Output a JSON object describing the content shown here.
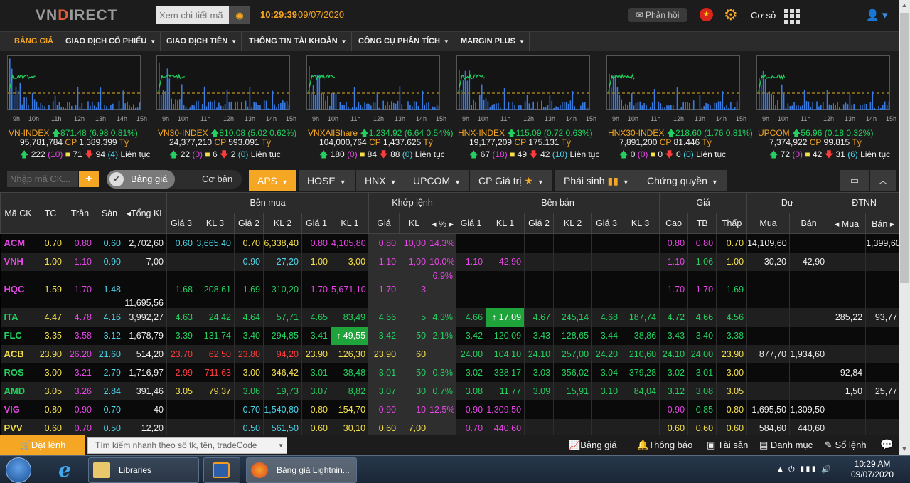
{
  "header": {
    "logo_a": "VN",
    "logo_b": "D",
    "logo_c": "IRECT",
    "search_placeholder": "Xem chi tiết mã",
    "time": "10:29:39",
    "date": "09/07/2020",
    "feedback": "Phản hồi",
    "mode": "Cơ sở"
  },
  "nav": [
    "BẢNG GIÁ",
    "GIAO DỊCH CỔ PHIẾU",
    "GIAO DỊCH TIỀN",
    "THÔNG TIN TÀI KHOẢN",
    "CÔNG CỤ PHÂN TÍCH",
    "MARGIN PLUS"
  ],
  "time_ticks": [
    "9h",
    "10h",
    "11h",
    "12h",
    "13h",
    "14h",
    "15h"
  ],
  "indexes": [
    {
      "name": "VN-INDEX",
      "value": "871.48",
      "change": "(6.98 0.81%)",
      "volume": "95,781,784",
      "cp": "CP",
      "amount": "1,389.399",
      "unit": "Tỷ",
      "up": "222",
      "ref": "(10)",
      "ceil": "71",
      "down": "94",
      "floor": "(4)",
      "status": "Liên tục"
    },
    {
      "name": "VN30-INDEX",
      "value": "810.08",
      "change": "(5.02 0.62%)",
      "volume": "24,377,210",
      "cp": "CP",
      "amount": "593.091",
      "unit": "Tỷ",
      "up": "22",
      "ref": "(0)",
      "ceil": "6",
      "down": "2",
      "floor": "(0)",
      "status": "Liên tục"
    },
    {
      "name": "VNXAllShare",
      "value": "1,234.92",
      "change": "(6.64 0.54%)",
      "volume": "104,000,764",
      "cp": "CP",
      "amount": "1,437.625",
      "unit": "Tỷ",
      "up": "180",
      "ref": "(0)",
      "ceil": "84",
      "down": "88",
      "floor": "(0)",
      "status": "Liên tục"
    },
    {
      "name": "HNX-INDEX",
      "value": "115.09",
      "change": "(0.72 0.63%)",
      "volume": "19,177,209",
      "cp": "CP",
      "amount": "175.131",
      "unit": "Tỷ",
      "up": "67",
      "ref": "(18)",
      "ceil": "49",
      "down": "42",
      "floor": "(10)",
      "status": "Liên tục"
    },
    {
      "name": "HNX30-INDEX",
      "value": "218.60",
      "change": "(1.76 0.81%)",
      "volume": "7,891,200",
      "cp": "CP",
      "amount": "81.446",
      "unit": "Tỷ",
      "up": "0",
      "ref": "(0)",
      "ceil": "0",
      "down": "0",
      "floor": "(0)",
      "status": "Liên tục"
    },
    {
      "name": "UPCOM",
      "value": "56.96",
      "change": "(0.18 0.32%)",
      "volume": "7,374,922",
      "cp": "CP",
      "amount": "99.815",
      "unit": "Tỷ",
      "up": "72",
      "ref": "(0)",
      "ceil": "42",
      "down": "31",
      "floor": "(6)",
      "status": "Liên tục"
    }
  ],
  "filter": {
    "search_placeholder": "Nhập mã CK...",
    "toggle_on": "Bảng giá",
    "toggle_off": "Cơ bản",
    "tabs": [
      "APS",
      "HOSE",
      "HNX",
      "UPCOM",
      "CP Giá trị",
      "Phái sinh",
      "Chứng quyền"
    ]
  },
  "table": {
    "groups": [
      "Mã CK",
      "TC",
      "Trần",
      "Sàn",
      "Tổng KL",
      "Bên mua",
      "Khớp lệnh",
      "Bên bán",
      "Giá",
      "Dư",
      "ĐTNN"
    ],
    "sub": [
      "Giá 3",
      "KL 3",
      "Giá 2",
      "KL 2",
      "Giá 1",
      "KL 1",
      "Giá",
      "KL",
      "%",
      "Giá 1",
      "KL 1",
      "Giá 2",
      "KL 2",
      "Giá 3",
      "KL 3",
      "Cao",
      "TB",
      "Thấp",
      "Mua",
      "Bán",
      "Mua",
      "Bán"
    ],
    "rows": [
      {
        "sym": "ACM",
        "tc": "0.70",
        "tran": "0.80",
        "san": "0.60",
        "tkl": "2,702,60",
        "g3": "0.60",
        "kl3": "3,665,40",
        "g2": "0.70",
        "kl2": "6,338,40",
        "g1": "0.80",
        "kl1": "4,105,80",
        "kg": "0.80",
        "kkl": "10,00",
        "kp": "14.3%",
        "sg1": "",
        "skl1": "",
        "sg2": "",
        "skl2": "",
        "sg3": "",
        "skl3": "",
        "cao": "0.80",
        "tb": "0.80",
        "thap": "0.70",
        "dmua": "14,109,60",
        "dban": "",
        "nmua": "",
        "nban": "1,399,60"
      },
      {
        "sym": "VNH",
        "tc": "1.00",
        "tran": "1.10",
        "san": "0.90",
        "tkl": "7,00",
        "g3": "",
        "kl3": "",
        "g2": "0.90",
        "kl2": "27,20",
        "g1": "1.00",
        "kl1": "3,00",
        "kg": "1.10",
        "kkl": "1,00",
        "kp": "10.0%",
        "sg1": "1.10",
        "skl1": "42,90",
        "sg2": "",
        "skl2": "",
        "sg3": "",
        "skl3": "",
        "cao": "1.10",
        "tb": "1.06",
        "thap": "1.00",
        "dmua": "30,20",
        "dban": "42,90",
        "nmua": "",
        "nban": ""
      },
      {
        "sym": "HQC",
        "tc": "1.59",
        "tran": "1.70",
        "san": "1.48",
        "tkl": "11,695,56",
        "g3": "1.68",
        "kl3": "208,61",
        "g2": "1.69",
        "kl2": "310,20",
        "g1": "1.70",
        "kl1": "5,671,10",
        "kg": "1.70",
        "kkl": "3",
        "kp": "6.9%",
        "sg1": "",
        "skl1": "",
        "sg2": "",
        "skl2": "",
        "sg3": "",
        "skl3": "",
        "cao": "1.70",
        "tb": "1.70",
        "thap": "1.69",
        "dmua": "",
        "dban": "",
        "nmua": "",
        "nban": ""
      },
      {
        "sym": "ITA",
        "tc": "4.47",
        "tran": "4.78",
        "san": "4.16",
        "tkl": "3,992,27",
        "g3": "4.63",
        "kl3": "24,42",
        "g2": "4.64",
        "kl2": "57,71",
        "g1": "4.65",
        "kl1": "83,49",
        "kg": "4.66",
        "kkl": "5",
        "kp": "4.3%",
        "sg1": "4.66",
        "skl1": "↑ 17,09",
        "sg2": "4.67",
        "skl2": "245,14",
        "sg3": "4.68",
        "skl3": "187,74",
        "cao": "4.72",
        "tb": "4.66",
        "thap": "4.56",
        "dmua": "",
        "dban": "",
        "nmua": "285,22",
        "nban": "93,77"
      },
      {
        "sym": "FLC",
        "tc": "3.35",
        "tran": "3.58",
        "san": "3.12",
        "tkl": "1,678,79",
        "g3": "3.39",
        "kl3": "131,74",
        "g2": "3.40",
        "kl2": "294,85",
        "g1": "3.41",
        "kl1": "↑ 49,55",
        "kg": "3.42",
        "kkl": "50",
        "kp": "2.1%",
        "sg1": "3.42",
        "skl1": "120,09",
        "sg2": "3.43",
        "skl2": "128,65",
        "sg3": "3.44",
        "skl3": "38,86",
        "cao": "3.43",
        "tb": "3.40",
        "thap": "3.38",
        "dmua": "",
        "dban": "",
        "nmua": "",
        "nban": ""
      },
      {
        "sym": "ACB",
        "tc": "23.90",
        "tran": "26.20",
        "san": "21.60",
        "tkl": "514,20",
        "g3": "23.70",
        "kl3": "62,50",
        "g2": "23.80",
        "kl2": "94,20",
        "g1": "23.90",
        "kl1": "126,30",
        "kg": "23.90",
        "kkl": "60",
        "kp": "",
        "sg1": "24.00",
        "skl1": "104,10",
        "sg2": "24.10",
        "skl2": "257,00",
        "sg3": "24.20",
        "skl3": "210,60",
        "cao": "24.10",
        "tb": "24.00",
        "thap": "23.90",
        "dmua": "877,70",
        "dban": "1,934,60",
        "nmua": "",
        "nban": ""
      },
      {
        "sym": "ROS",
        "tc": "3.00",
        "tran": "3.21",
        "san": "2.79",
        "tkl": "1,716,97",
        "g3": "2.99",
        "kl3": "711,63",
        "g2": "3.00",
        "kl2": "346,42",
        "g1": "3.01",
        "kl1": "38,48",
        "kg": "3.01",
        "kkl": "50",
        "kp": "0.3%",
        "sg1": "3.02",
        "skl1": "338,17",
        "sg2": "3.03",
        "skl2": "356,02",
        "sg3": "3.04",
        "skl3": "379,28",
        "cao": "3.02",
        "tb": "3.01",
        "thap": "3.00",
        "dmua": "",
        "dban": "",
        "nmua": "92,84",
        "nban": ""
      },
      {
        "sym": "AMD",
        "tc": "3.05",
        "tran": "3.26",
        "san": "2.84",
        "tkl": "391,46",
        "g3": "3.05",
        "kl3": "79,37",
        "g2": "3.06",
        "kl2": "19,73",
        "g1": "3.07",
        "kl1": "8,82",
        "kg": "3.07",
        "kkl": "30",
        "kp": "0.7%",
        "sg1": "3.08",
        "skl1": "11,77",
        "sg2": "3.09",
        "skl2": "15,91",
        "sg3": "3.10",
        "skl3": "84,04",
        "cao": "3.12",
        "tb": "3.08",
        "thap": "3.05",
        "dmua": "",
        "dban": "",
        "nmua": "1,50",
        "nban": "25,77"
      },
      {
        "sym": "VIG",
        "tc": "0.80",
        "tran": "0.90",
        "san": "0.70",
        "tkl": "40",
        "g3": "",
        "kl3": "",
        "g2": "0.70",
        "kl2": "1,540,80",
        "g1": "0.80",
        "kl1": "154,70",
        "kg": "0.90",
        "kkl": "10",
        "kp": "12.5%",
        "sg1": "0.90",
        "skl1": "1,309,50",
        "sg2": "",
        "skl2": "",
        "sg3": "",
        "skl3": "",
        "cao": "0.90",
        "tb": "0.85",
        "thap": "0.80",
        "dmua": "1,695,50",
        "dban": "1,309,50",
        "nmua": "",
        "nban": ""
      },
      {
        "sym": "PVV",
        "tc": "0.60",
        "tran": "0.70",
        "san": "0.50",
        "tkl": "12,20",
        "g3": "",
        "kl3": "",
        "g2": "0.50",
        "kl2": "561,50",
        "g1": "0.60",
        "kl1": "30,10",
        "kg": "0.60",
        "kkl": "7,00",
        "kp": "",
        "sg1": "0.70",
        "skl1": "440,60",
        "sg2": "",
        "skl2": "",
        "sg3": "",
        "skl3": "",
        "cao": "0.60",
        "tb": "0.60",
        "thap": "0.60",
        "dmua": "584,60",
        "dban": "440,60",
        "nmua": "",
        "nban": ""
      }
    ]
  },
  "bottom": {
    "order": "Đặt lệnh",
    "quick_search": "Tìm kiếm nhanh theo số tk, tên, tradeCode",
    "links": [
      "Bảng giá",
      "Thông báo",
      "Tài sản",
      "Danh mục",
      "Sổ lệnh"
    ]
  },
  "taskbar": {
    "libraries": "Libraries",
    "browser": "Bảng giá Lightnin...",
    "time": "10:29 AM",
    "date": "09/07/2020"
  },
  "colors": {
    "accent": "#f5a623",
    "up": "#23d160",
    "down": "#ff3b3b",
    "ceiling": "#e546e5",
    "floor": "#4ad4e8",
    "ref": "#f5e04a"
  }
}
